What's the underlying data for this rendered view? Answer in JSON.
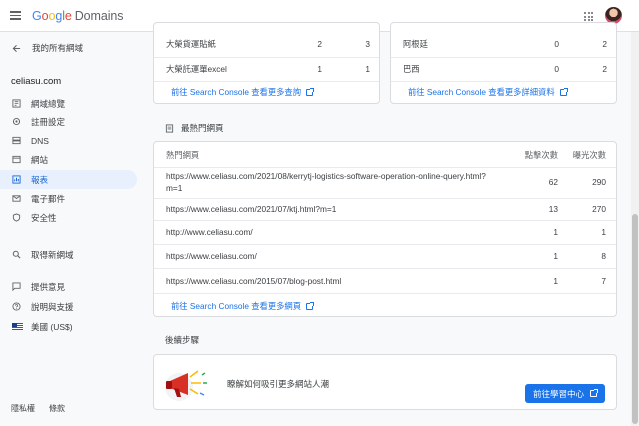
{
  "app": {
    "brand_google": "Google",
    "brand_product": "Domains"
  },
  "sidebar": {
    "back_label": "我的所有網域",
    "domain": "celiasu.com",
    "items": [
      {
        "label": "網域總覽",
        "icon": "dashboard-icon"
      },
      {
        "label": "註冊設定",
        "icon": "settings-icon"
      },
      {
        "label": "DNS",
        "icon": "dns-icon"
      },
      {
        "label": "網站",
        "icon": "website-icon"
      },
      {
        "label": "報表",
        "icon": "reports-icon",
        "active": true
      },
      {
        "label": "電子郵件",
        "icon": "email-icon"
      },
      {
        "label": "安全性",
        "icon": "security-icon"
      }
    ],
    "get_domain": "取得新網域",
    "feedback": "提供意見",
    "help": "說明與支援",
    "locale": "美國 (US$)",
    "footer_privacy": "隱私權",
    "footer_terms": "條款"
  },
  "queries_card": {
    "rows": [
      {
        "query": "大榮貨運貼紙",
        "clicks": "2",
        "impressions": "3"
      },
      {
        "query": "大榮託運單excel",
        "clicks": "1",
        "impressions": "1"
      }
    ],
    "link": "前往 Search Console 查看更多查詢"
  },
  "countries_card": {
    "rows": [
      {
        "country": "阿根廷",
        "clicks": "0",
        "impressions": "2"
      },
      {
        "country": "巴西",
        "clicks": "0",
        "impressions": "2"
      }
    ],
    "link": "前往 Search Console 查看更多詳細資料"
  },
  "top_pages": {
    "section_title": "最熱門網頁",
    "headers": {
      "page": "熱門網頁",
      "clicks": "點擊次數",
      "impressions": "曝光次數"
    },
    "rows": [
      {
        "url": "https://www.celiasu.com/2021/08/kerrytj-logistics-software-operation-online-query.html?m=1",
        "clicks": "62",
        "impressions": "290"
      },
      {
        "url": "https://www.celiasu.com/2021/07/ktj.html?m=1",
        "clicks": "13",
        "impressions": "270"
      },
      {
        "url": "http://www.celiasu.com/",
        "clicks": "1",
        "impressions": "1"
      },
      {
        "url": "https://www.celiasu.com/",
        "clicks": "1",
        "impressions": "8"
      },
      {
        "url": "https://www.celiasu.com/2015/07/blog-post.html",
        "clicks": "1",
        "impressions": "7"
      }
    ],
    "link": "前往 Search Console 查看更多網頁"
  },
  "next_steps": {
    "title": "後續步驟",
    "text": "瞭解如何吸引更多網站人潮",
    "button": "前往學習中心"
  },
  "colors": {
    "accent": "#1a73e8",
    "active_bg": "#e8f0fe",
    "megaphone": "#d93025"
  }
}
